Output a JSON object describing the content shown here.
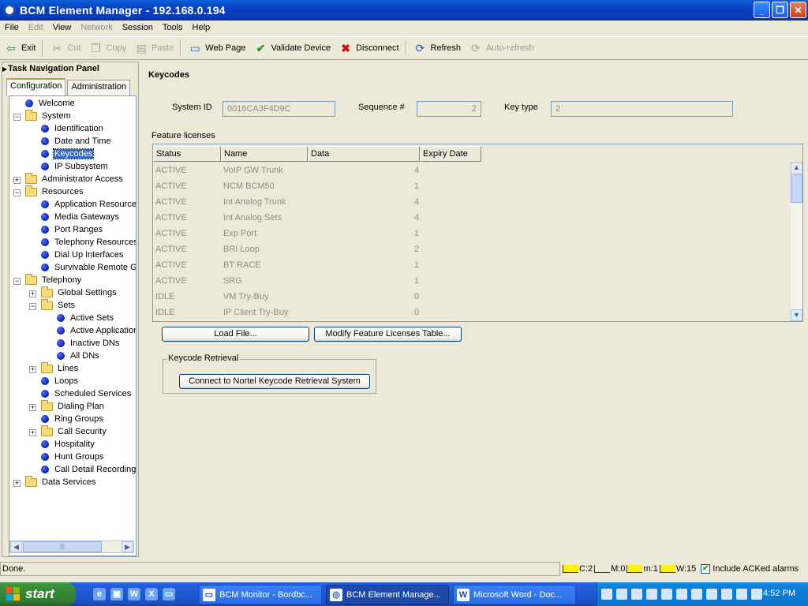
{
  "window": {
    "title": "BCM Element Manager - 192.168.0.194"
  },
  "menu": [
    {
      "label": "File",
      "enabled": true
    },
    {
      "label": "Edit",
      "enabled": false
    },
    {
      "label": "View",
      "enabled": true
    },
    {
      "label": "Network",
      "enabled": false
    },
    {
      "label": "Session",
      "enabled": true
    },
    {
      "label": "Tools",
      "enabled": true
    },
    {
      "label": "Help",
      "enabled": true
    }
  ],
  "toolbar": {
    "exit": "Exit",
    "cut": "Cut",
    "copy": "Copy",
    "paste": "Paste",
    "web_page": "Web Page",
    "validate": "Validate Device",
    "disconnect": "Disconnect",
    "refresh": "Refresh",
    "auto_refresh": "Auto-refresh"
  },
  "nav": {
    "title": "Task Navigation Panel",
    "tabs": [
      "Configuration",
      "Administration"
    ],
    "tree": [
      {
        "label": "Welcome"
      },
      {
        "label": "System"
      },
      {
        "label": "Identification"
      },
      {
        "label": "Date and Time"
      },
      {
        "label": "Keycodes"
      },
      {
        "label": "IP Subsystem"
      },
      {
        "label": "Administrator Access"
      },
      {
        "label": "Resources"
      },
      {
        "label": "Application Resources"
      },
      {
        "label": "Media Gateways"
      },
      {
        "label": "Port Ranges"
      },
      {
        "label": "Telephony Resources"
      },
      {
        "label": "Dial Up Interfaces"
      },
      {
        "label": "Survivable Remote Gateway"
      },
      {
        "label": "Telephony"
      },
      {
        "label": "Global Settings"
      },
      {
        "label": "Sets"
      },
      {
        "label": "Active Sets"
      },
      {
        "label": "Active Applications"
      },
      {
        "label": "Inactive DNs"
      },
      {
        "label": "All DNs"
      },
      {
        "label": "Lines"
      },
      {
        "label": "Loops"
      },
      {
        "label": "Scheduled Services"
      },
      {
        "label": "Dialing Plan"
      },
      {
        "label": "Ring Groups"
      },
      {
        "label": "Call Security"
      },
      {
        "label": "Hospitality"
      },
      {
        "label": "Hunt Groups"
      },
      {
        "label": "Call Detail Recording"
      },
      {
        "label": "Data Services"
      }
    ]
  },
  "keycodes": {
    "title": "Keycodes",
    "system_id_label": "System ID",
    "system_id": "0016CA3F4D9C",
    "sequence_label": "Sequence #",
    "sequence": "2",
    "key_type_label": "Key type",
    "key_type": "2",
    "feature_licenses_label": "Feature licenses",
    "columns": [
      "Status",
      "Name",
      "Data",
      "Expiry Date"
    ],
    "rows": [
      {
        "status": "ACTIVE",
        "name": "VoIP GW Trunk",
        "data": "4"
      },
      {
        "status": "ACTIVE",
        "name": "NCM BCM50",
        "data": "1"
      },
      {
        "status": "ACTIVE",
        "name": "Int Analog Trunk",
        "data": "4"
      },
      {
        "status": "ACTIVE",
        "name": "Int Analog Sets",
        "data": "4"
      },
      {
        "status": "ACTIVE",
        "name": "Exp Port",
        "data": "1"
      },
      {
        "status": "ACTIVE",
        "name": "BRI Loop",
        "data": "2"
      },
      {
        "status": "ACTIVE",
        "name": "BT RACE",
        "data": "1"
      },
      {
        "status": "ACTIVE",
        "name": "SRG",
        "data": "1"
      },
      {
        "status": "IDLE",
        "name": "VM Try-Buy",
        "data": "0"
      },
      {
        "status": "IDLE",
        "name": "IP Client Try-Buy",
        "data": "0"
      }
    ],
    "load_file": "Load File...",
    "modify_table": "Modify Feature Licenses Table...",
    "retrieval_group": "Keycode Retrieval",
    "connect_nortel": "Connect to Nortel Keycode Retrieval System"
  },
  "status": {
    "text": "Done.",
    "alarms": [
      {
        "label": "C:2",
        "color": "#FFF200"
      },
      {
        "label": "M:0",
        "color": "#ECE9D8"
      },
      {
        "label": "m:1",
        "color": "#FFF200"
      },
      {
        "label": "W:15",
        "color": "#FFF200"
      }
    ],
    "include_acked": "Include ACKed alarms"
  },
  "taskbar": {
    "start": "start",
    "tasks": [
      "BCM Monitor - Bordbc...",
      "BCM Element Manage...",
      "Microsoft Word - Doc..."
    ],
    "clock": "4:52 PM"
  }
}
